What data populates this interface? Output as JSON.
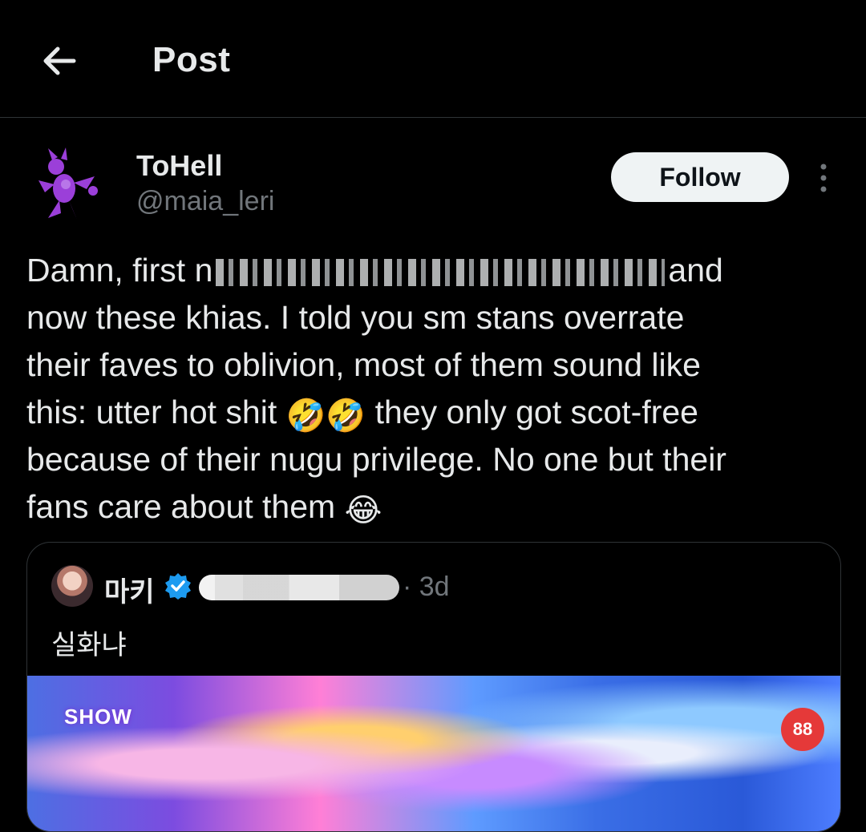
{
  "header": {
    "title": "Post",
    "back_icon": "arrow-left-icon"
  },
  "author": {
    "name": "ToHell",
    "handle": "@maia_leri",
    "follow_label": "Follow",
    "avatar_icon": "purple-character-avatar",
    "more_icon": "more-vertical-icon"
  },
  "post": {
    "line1_start": "Damn, first n",
    "line1_end": "and",
    "line2": "now these khias. I told you sm stans overrate",
    "line3": "their faves to oblivion, most of them sound like",
    "line4_start": "this: utter hot shit ",
    "line4_emoji": "🤣🤣",
    "line4_end": " they only got scot-free",
    "line5": "because of their nugu privilege. No one but their",
    "line6_start": "fans care about them ",
    "line6_emoji": "😂"
  },
  "quote": {
    "name": "마키",
    "verified_icon": "verified-badge-icon",
    "time": "· 3d",
    "text": "실화냐",
    "media_logo": "SHOW",
    "media_badge": "88"
  }
}
